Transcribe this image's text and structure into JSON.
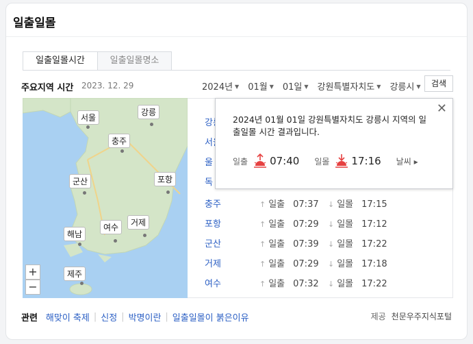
{
  "title": "일출일몰",
  "tabs": [
    {
      "label": "일출일몰시간",
      "active": true
    },
    {
      "label": "일출일몰명소",
      "active": false
    }
  ],
  "section": {
    "title": "주요지역 시간",
    "date": "2023. 12. 29"
  },
  "filters": {
    "year": "2024년",
    "month": "01월",
    "day": "01일",
    "province": "강원특별자치도",
    "city": "강릉시"
  },
  "search_label": "검색",
  "map": {
    "cities": [
      "서울",
      "강릉",
      "충주",
      "포항",
      "군산",
      "여수",
      "거제",
      "해남",
      "제주"
    ],
    "zoom_in": "+",
    "zoom_out": "−"
  },
  "popup": {
    "message": "2024년 01월 01일 강원특별자치도 강릉시 지역의 일출일몰 시간 결과입니다.",
    "sunrise_label": "일출",
    "sunrise_time": "07:40",
    "sunset_label": "일몰",
    "sunset_time": "17:16",
    "weather_label": "날씨",
    "rise_color": "#e64141",
    "set_color": "#e64141"
  },
  "rows": [
    {
      "city": "강릉",
      "rise": "",
      "set": ""
    },
    {
      "city": "서울",
      "rise": "",
      "set": ""
    },
    {
      "city": "울",
      "rise": "",
      "set": ""
    },
    {
      "city": "독",
      "rise": "",
      "set": ""
    },
    {
      "city": "충주",
      "rise": "07:37",
      "set": "17:15"
    },
    {
      "city": "포항",
      "rise": "07:29",
      "set": "17:12"
    },
    {
      "city": "군산",
      "rise": "07:39",
      "set": "17:22"
    },
    {
      "city": "거제",
      "rise": "07:29",
      "set": "17:18"
    },
    {
      "city": "여수",
      "rise": "07:32",
      "set": "17:22"
    }
  ],
  "row_labels": {
    "rise": "일출",
    "set": "일몰"
  },
  "related": {
    "label": "관련",
    "links": [
      "해맞이 축제",
      "신정",
      "박명이란",
      "일출일몰이 붉은이유"
    ]
  },
  "provider": {
    "label": "제공",
    "name": "천문우주지식포털"
  },
  "colors": {
    "link": "#2b5fc4",
    "sea": "#a9d0f2",
    "land": "#cfe1c6"
  }
}
